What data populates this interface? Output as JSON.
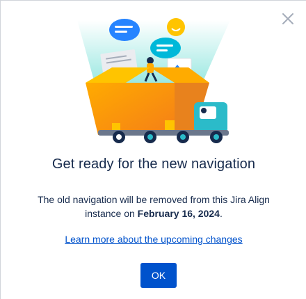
{
  "dialog": {
    "title": "Get ready for the new navigation",
    "body_prefix": "The old navigation will be removed from this Jira Align instance on ",
    "body_date": "February 16, 2024",
    "body_suffix": ".",
    "learn_link": "Learn more about the upcoming changes",
    "ok_label": "OK"
  },
  "icons": {
    "close": "close-icon",
    "illustration": "moving-truck-illustration"
  },
  "colors": {
    "primary": "#0052cc",
    "text": "#172b4d",
    "close": "#8993a4",
    "box_orange": "#f79232",
    "truck_teal": "#2bbbc9"
  }
}
